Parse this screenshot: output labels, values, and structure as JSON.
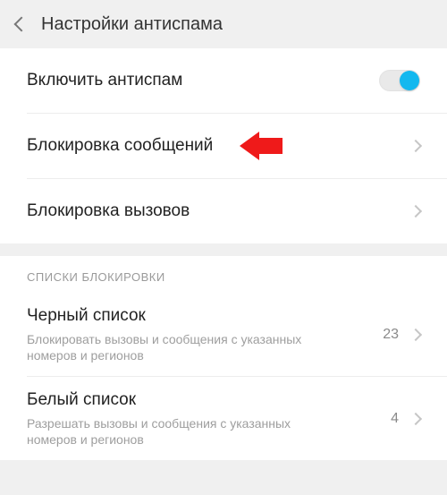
{
  "header": {
    "title": "Настройки антиспама"
  },
  "rows": {
    "enable": {
      "title": "Включить антиспам"
    },
    "block_messages": {
      "title": "Блокировка сообщений"
    },
    "block_calls": {
      "title": "Блокировка вызовов"
    }
  },
  "section": {
    "blocklists_header": "СПИСКИ БЛОКИРОВКИ",
    "blacklist": {
      "title": "Черный список",
      "subtitle": "Блокировать вызовы и сообщения с указанных номеров и регионов",
      "count": "23"
    },
    "whitelist": {
      "title": "Белый список",
      "subtitle": "Разрешать вызовы и сообщения с указанных номеров и регионов",
      "count": "4"
    }
  },
  "toggle": {
    "enabled": true
  },
  "colors": {
    "accent": "#13b8ef",
    "annotation": "#ef1a1a"
  }
}
